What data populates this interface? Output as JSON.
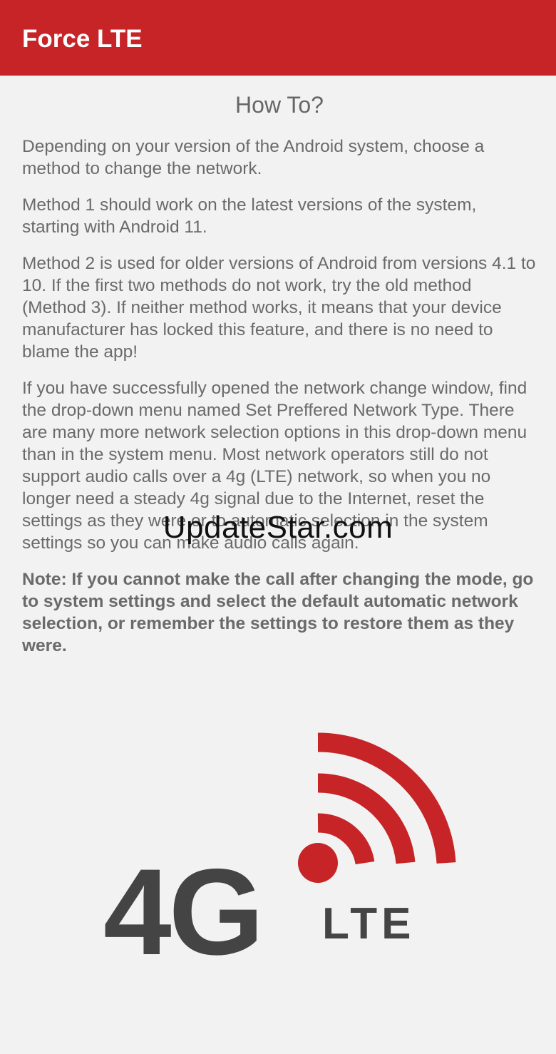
{
  "app_bar": {
    "title": "Force LTE"
  },
  "content": {
    "heading": "How To?",
    "paragraphs": [
      "Depending on your version of the Android system, choose a method to change the network.",
      "Method 1 should work on the latest versions of the system, starting with Android 11.",
      "Method 2 is used for older versions of Android from versions 4.1 to 10. If the first two methods do not work, try the old method (Method 3). If neither method works, it means that your device manufacturer has locked this feature, and there is no need to blame the app!",
      "If you have successfully opened the network change window, find the drop-down menu named Set Preffered Network Type. There are many more network selection options in this drop-down menu than in the system menu. Most network operators still do not support audio calls over a 4g (LTE) network, so when you no longer need a steady 4g signal due to the Internet, reset the settings as they were or to automatic selection in the system settings so you can make audio calls again."
    ],
    "note": "Note: If you cannot make the call after changing the mode, go to system settings and select the default automatic network selection, or remember the settings to restore them as they were."
  },
  "watermark": "UpdateStar.com",
  "logo": {
    "main_text": "4G",
    "sub_text": "LTE",
    "colors": {
      "red": "#c62427",
      "dark": "#444444"
    }
  }
}
